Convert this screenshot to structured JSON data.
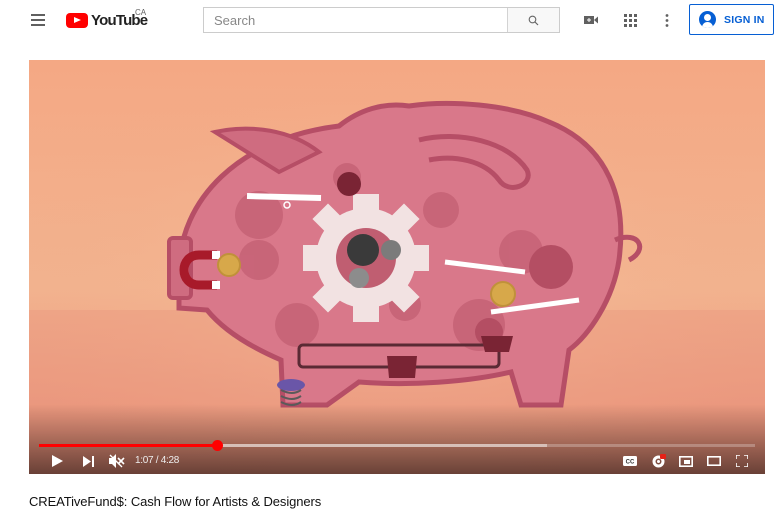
{
  "masthead": {
    "logo_text": "YouTube",
    "country_code": "CA",
    "search_placeholder": "Search",
    "sign_in_label": "SIGN IN"
  },
  "player": {
    "current_time": "1:07",
    "duration": "4:28",
    "time_separator": " / ",
    "played_fraction": 0.249,
    "buffered_fraction": 0.71,
    "muted": true
  },
  "video": {
    "title": "CREATiveFund$: Cash Flow for Artists & Designers"
  },
  "colors": {
    "brand_red": "#ff0000",
    "sign_in_blue": "#065fd4",
    "scene_background": "#f3ab8a",
    "pig_body": "#d9788a"
  }
}
